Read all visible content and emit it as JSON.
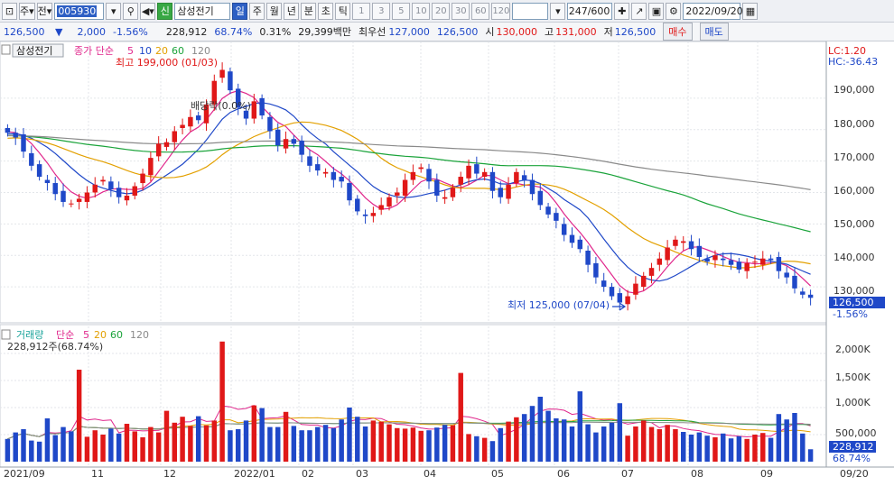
{
  "toolbar": {
    "market": "주",
    "prev": "전",
    "code": "005930",
    "new_badge": "신",
    "stock_name": "삼성전기",
    "periods": [
      "일",
      "주",
      "월",
      "년",
      "분",
      "초",
      "틱"
    ],
    "active_period": "일",
    "numbers": [
      "1",
      "3",
      "5",
      "10",
      "20",
      "30",
      "60",
      "120"
    ],
    "count": "247/600",
    "date": "2022/09/20"
  },
  "infobar": {
    "price": "126,500",
    "change": "2,000",
    "change_pct": "-1.56%",
    "volume": "228,912",
    "vol_ratio": "68.74%",
    "turnover": "0.31%",
    "trade_value": "29,399백만",
    "best_ask_label": "최우선",
    "best_ask": "127,000",
    "best_bid": "126,500",
    "open_label": "시",
    "open": "130,000",
    "high_label": "고",
    "high": "131,000",
    "low_label": "저",
    "low": "126,500",
    "buy_label": "매수",
    "sell_label": "매도"
  },
  "price_pane": {
    "stock_tag": "삼성전기",
    "ma_label": "종가 단순",
    "ma_periods": [
      "5",
      "10",
      "20",
      "60",
      "120"
    ],
    "ma_colors": [
      "#e0278c",
      "#1f48c8",
      "#e3a000",
      "#1aa33a",
      "#8a8a8a"
    ],
    "lc_label": "LC:1.20",
    "hc_label": "HC:-36.43",
    "high_annotation": "최고 199,000 (01/03)",
    "low_annotation": "최저 125,000 (07/04)",
    "dividend_annotation": "배당락(0.0%)",
    "y_ticks": [
      "190,000",
      "180,000",
      "170,000",
      "160,000",
      "150,000",
      "140,000",
      "130,000"
    ],
    "current_price": "126,500",
    "current_pct": "-1.56%"
  },
  "volume_pane": {
    "label": "거래량",
    "ma_label": "단순",
    "ma_periods": [
      "5",
      "20",
      "60",
      "120"
    ],
    "value_text": "228,912주(68.74%)",
    "y_ticks": [
      "2,000K",
      "1,500K",
      "1,000K",
      "500,000"
    ],
    "current_volume": "228,912",
    "current_pct": "68.74%"
  },
  "x_axis": {
    "labels": [
      "2021/09",
      "11",
      "12",
      "2022/01",
      "02",
      "03",
      "04",
      "05",
      "06",
      "07",
      "08",
      "09"
    ],
    "right_label": "09/20"
  },
  "chart_data": {
    "type": "candlestick",
    "ma_periods": [
      5,
      10,
      20,
      60,
      120
    ],
    "ylim": [
      125000,
      200000
    ],
    "volume_ylim": [
      0,
      2300000
    ],
    "closes": [
      179000,
      177500,
      173000,
      168500,
      165000,
      163000,
      159500,
      157000,
      156500,
      158000,
      160000,
      162500,
      164000,
      161000,
      158500,
      159000,
      162000,
      166000,
      171000,
      175500,
      176000,
      179500,
      181500,
      184000,
      183000,
      188000,
      195500,
      199000,
      192500,
      187000,
      183500,
      189000,
      184500,
      179500,
      175000,
      177000,
      175500,
      172000,
      168500,
      167000,
      166500,
      164000,
      163500,
      157500,
      154000,
      152500,
      153500,
      156000,
      158500,
      160000,
      164000,
      166500,
      168000,
      163500,
      159000,
      158500,
      161500,
      165000,
      168500,
      166000,
      166500,
      160500,
      158500,
      162500,
      166500,
      164000,
      159500,
      156000,
      153000,
      151000,
      146500,
      144000,
      142000,
      137000,
      133000,
      130000,
      127000,
      125000,
      127000,
      131000,
      133500,
      136000,
      139000,
      142500,
      145000,
      144500,
      142000,
      139500,
      138000,
      140000,
      138500,
      137000,
      135500,
      137500,
      138000,
      139000,
      138500,
      135000,
      133000,
      129500,
      127500,
      126500
    ],
    "volumes": [
      420000,
      540000,
      600000,
      390000,
      370000,
      800000,
      490000,
      640000,
      560000,
      1700000,
      460000,
      580000,
      500000,
      610000,
      520000,
      700000,
      560000,
      450000,
      640000,
      540000,
      940000,
      720000,
      830000,
      660000,
      840000,
      670000,
      760000,
      2220000,
      580000,
      600000,
      760000,
      1040000,
      990000,
      640000,
      640000,
      920000,
      660000,
      580000,
      580000,
      640000,
      680000,
      620000,
      780000,
      1000000,
      830000,
      650000,
      760000,
      740000,
      690000,
      620000,
      610000,
      630000,
      570000,
      580000,
      630000,
      680000,
      670000,
      1640000,
      510000,
      470000,
      440000,
      380000,
      620000,
      740000,
      820000,
      880000,
      1030000,
      1200000,
      940000,
      800000,
      780000,
      650000,
      1300000,
      690000,
      540000,
      650000,
      720000,
      1080000,
      480000,
      650000,
      760000,
      640000,
      600000,
      680000,
      600000,
      550000,
      500000,
      540000,
      480000,
      450000,
      520000,
      430000,
      470000,
      420000,
      500000,
      530000,
      440000,
      880000,
      780000,
      900000,
      520000,
      228912
    ]
  }
}
